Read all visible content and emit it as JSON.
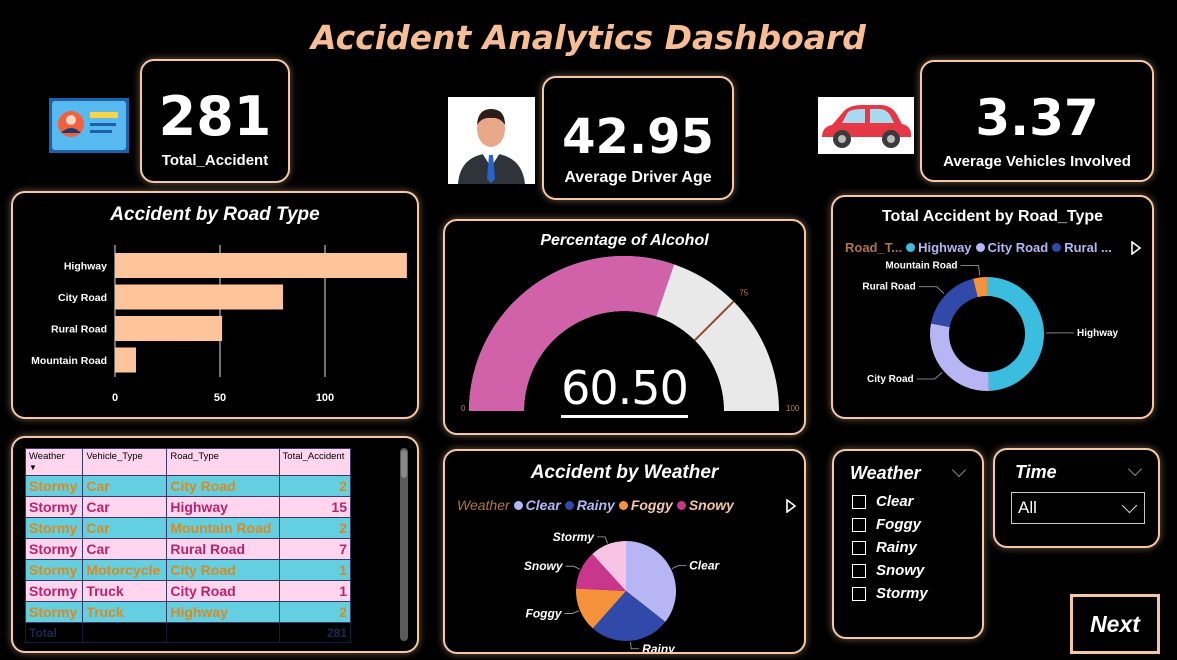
{
  "dashboard": {
    "title": "Accident Analytics Dashboard"
  },
  "kpis": {
    "total_accident": {
      "value": "281",
      "label": "Total_Accident"
    },
    "avg_driver_age": {
      "value": "42.95",
      "label": "Average Driver Age"
    },
    "avg_vehicles": {
      "value": "3.37",
      "label": "Average Vehicles Involved"
    }
  },
  "icons": {
    "id_card": "id-card-icon",
    "driver": "driver-person-icon",
    "car": "car-icon"
  },
  "road_bar": {
    "title": "Accident by Road Type",
    "chart_data": {
      "type": "bar",
      "orientation": "horizontal",
      "categories": [
        "Highway",
        "City Road",
        "Rural Road",
        "Mountain Road"
      ],
      "values": [
        139,
        80,
        51,
        10
      ],
      "xlim": [
        0,
        140
      ],
      "ticks": [
        0,
        50,
        100
      ],
      "tick_labels": [
        "0",
        "50",
        "100"
      ],
      "color": "#ffc49a"
    }
  },
  "gauge": {
    "title": "Percentage of Alcohol",
    "value_label": "60.50",
    "chart_data": {
      "type": "gauge",
      "value": 60.5,
      "min": 0,
      "max": 100,
      "target": 75,
      "min_label": "0",
      "max_label": "100",
      "target_label": "75",
      "fill_color": "#d162aa",
      "track_color": "#e9e9e9",
      "target_color": "#8b4a2a"
    }
  },
  "road_donut": {
    "title": "Total Accident by Road_Type",
    "legend_label": "Road_T...",
    "legend": [
      {
        "name": "Highway",
        "color": "#3bbde0"
      },
      {
        "name": "City Road",
        "color": "#b8b5f5"
      },
      {
        "name": "Rural ...",
        "color": "#3149a8"
      }
    ],
    "chart_data": {
      "type": "pie",
      "variant": "donut",
      "labels": [
        "Highway",
        "City Road",
        "Rural Road",
        "Mountain Road"
      ],
      "values": [
        139,
        80,
        51,
        11
      ],
      "colors": [
        "#3bbde0",
        "#b8b5f5",
        "#3149a8",
        "#f7923c"
      ]
    }
  },
  "weather_pie": {
    "title": "Accident by Weather",
    "legend_label": "Weather",
    "legend": [
      {
        "name": "Clear",
        "color": "#b8b5f5"
      },
      {
        "name": "Rainy",
        "color": "#3149a8"
      },
      {
        "name": "Foggy",
        "color": "#f7923c"
      },
      {
        "name": "Snowy",
        "color": "#c9378d"
      }
    ],
    "chart_data": {
      "type": "pie",
      "labels": [
        "Clear",
        "Rainy",
        "Foggy",
        "Snowy",
        "Stormy"
      ],
      "values": [
        100,
        73,
        40,
        35,
        33
      ],
      "colors": [
        "#b8b5f5",
        "#3149a8",
        "#f7923c",
        "#c9378d",
        "#f8c4e6"
      ]
    }
  },
  "table": {
    "headers": [
      "Weather",
      "Vehicle_Type",
      "Road_Type",
      "Total_Accident"
    ],
    "rows": [
      [
        "Stormy",
        "Car",
        "City Road",
        "2"
      ],
      [
        "Stormy",
        "Car",
        "Highway",
        "15"
      ],
      [
        "Stormy",
        "Car",
        "Mountain Road",
        "2"
      ],
      [
        "Stormy",
        "Car",
        "Rural Road",
        "7"
      ],
      [
        "Stormy",
        "Motorcycle",
        "City Road",
        "1"
      ],
      [
        "Stormy",
        "Truck",
        "City Road",
        "1"
      ],
      [
        "Stormy",
        "Truck",
        "Highway",
        "2"
      ]
    ],
    "total_label": "Total",
    "total_value": "281"
  },
  "weather_slicer": {
    "title": "Weather",
    "options": [
      "Clear",
      "Foggy",
      "Rainy",
      "Snowy",
      "Stormy"
    ]
  },
  "time_slicer": {
    "title": "Time",
    "selected": "All"
  },
  "nav": {
    "next_label": "Next"
  }
}
